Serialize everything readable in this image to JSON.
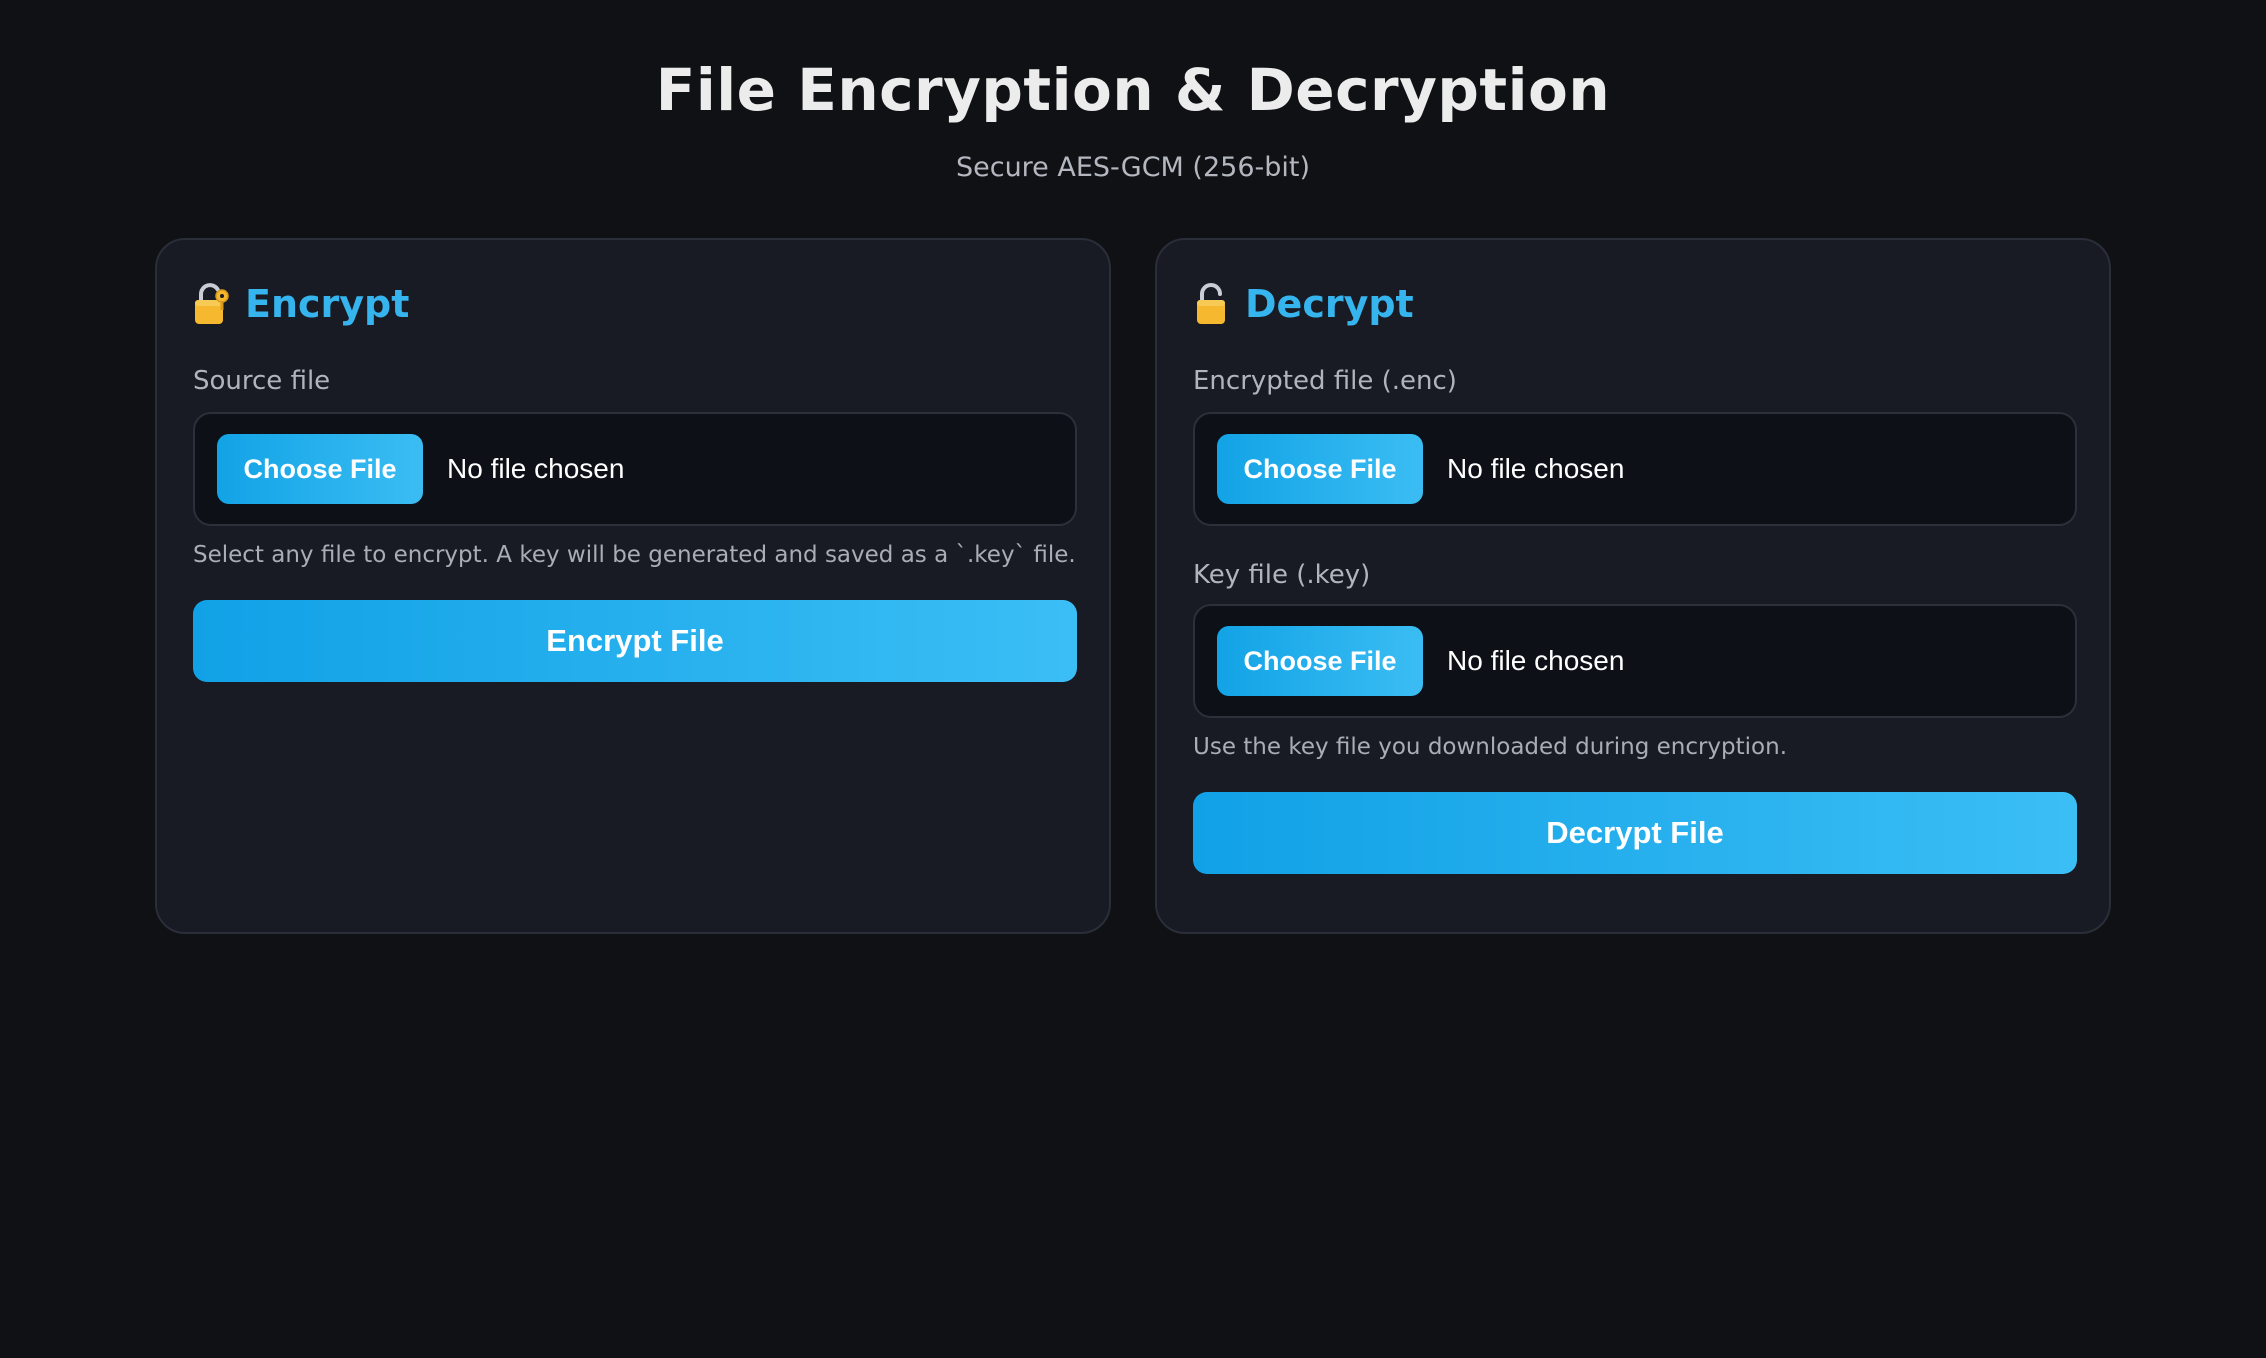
{
  "header": {
    "title": "File Encryption & Decryption",
    "subtitle": "Secure AES-GCM (256-bit)"
  },
  "encrypt": {
    "icon": "unlocked-lock-with-key-icon",
    "title": "Encrypt",
    "source_label": "Source file",
    "choose_label": "Choose File",
    "file_status": "No file chosen",
    "hint": "Select any file to encrypt. A key will be generated and saved as a `.key` file.",
    "action_label": "Encrypt File"
  },
  "decrypt": {
    "icon": "unlocked-padlock-icon",
    "title": "Decrypt",
    "encrypted_label": "Encrypted file (.enc)",
    "encrypted_choose_label": "Choose File",
    "encrypted_file_status": "No file chosen",
    "key_label": "Key file (.key)",
    "key_choose_label": "Choose File",
    "key_file_status": "No file chosen",
    "hint": "Use the key file you downloaded during encryption.",
    "action_label": "Decrypt File"
  },
  "colors": {
    "background": "#0f1115",
    "card": "#181b23",
    "accent": "#36b4ee",
    "button_start": "#11a1e6",
    "button_end": "#3bbef5",
    "lock_gold": "#f5b82e"
  }
}
